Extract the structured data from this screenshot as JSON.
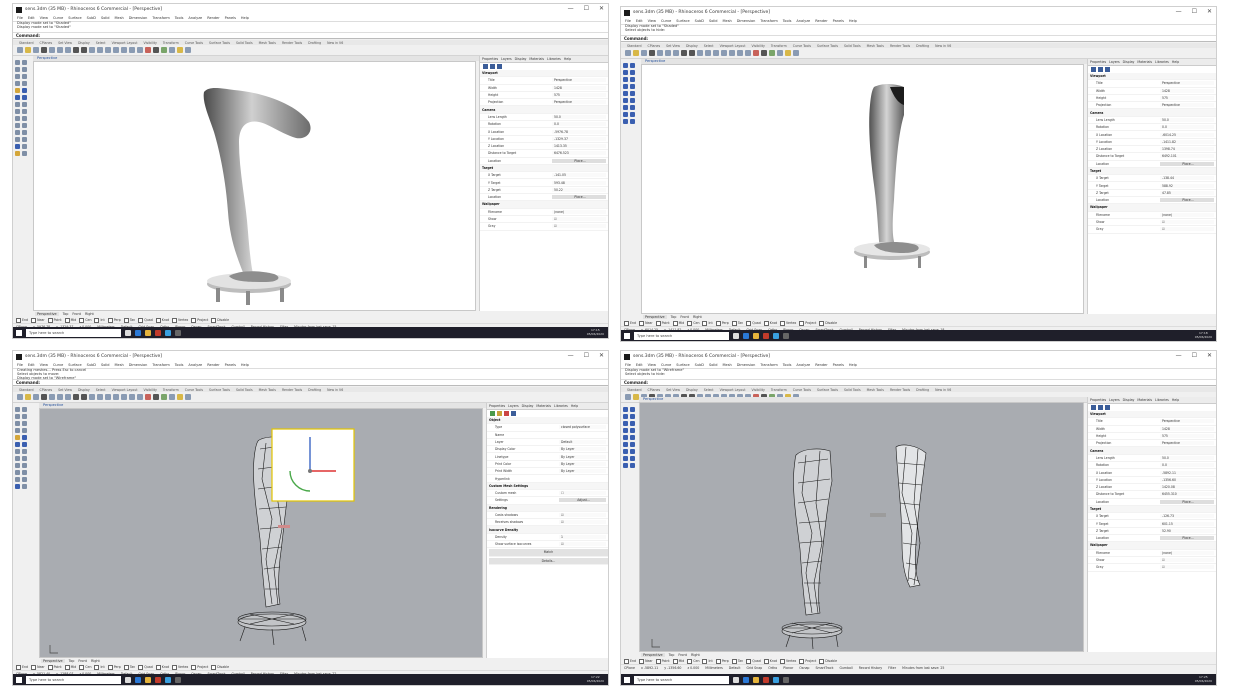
{
  "window_title": "sens.3dm (35 MB) - Rhinoceros 6 Commercial - [Perspective]",
  "window_controls": {
    "minimize": "—",
    "maximize": "☐",
    "close": "✕"
  },
  "menu": [
    "File",
    "Edit",
    "View",
    "Curve",
    "Surface",
    "SubD",
    "Solid",
    "Mesh",
    "Dimension",
    "Transform",
    "Tools",
    "Analyze",
    "Render",
    "Panels",
    "Help"
  ],
  "toolbar_tabs": [
    "Standard",
    "CPlanes",
    "Set View",
    "Display",
    "Select",
    "Viewport Layout",
    "Visibility",
    "Transform",
    "Curve Tools",
    "Surface Tools",
    "Solid Tools",
    "Mesh Tools",
    "Render Tools",
    "Drafting",
    "New in V6"
  ],
  "windows": [
    {
      "command_history": [
        "Display mode set to \"Shaded\"",
        "Display mode set to \"Shaded\""
      ],
      "command_prompt": "Command:",
      "viewport_label": "Perspective",
      "panel_tabs": [
        "Properties",
        "Layers",
        "Display",
        "Materials",
        "Libraries",
        "Help"
      ],
      "properties": [
        {
          "section": "Viewport"
        },
        {
          "label": "Title",
          "value": "Perspective"
        },
        {
          "label": "Width",
          "value": "1428"
        },
        {
          "label": "Height",
          "value": "575"
        },
        {
          "label": "Projection",
          "value": "Perspective"
        },
        {
          "section": "Camera"
        },
        {
          "label": "Lens Length",
          "value": "50.0"
        },
        {
          "label": "Rotation",
          "value": "0.0"
        },
        {
          "label": "X Location",
          "value": "-5976.78"
        },
        {
          "label": "Y Location",
          "value": "-1329.37"
        },
        {
          "label": "Z Location",
          "value": "1413.35"
        },
        {
          "label": "Distance to Target",
          "value": "6476.523"
        },
        {
          "label": "Location",
          "value": "Place...",
          "button": true
        },
        {
          "section": "Target"
        },
        {
          "label": "X Target",
          "value": "-141.05"
        },
        {
          "label": "Y Target",
          "value": "593.48"
        },
        {
          "label": "Z Target",
          "value": "50.22"
        },
        {
          "label": "Location",
          "value": "Place...",
          "button": true
        },
        {
          "section": "Wallpaper"
        },
        {
          "label": "Filename",
          "value": "(none)"
        },
        {
          "label": "Show",
          "value": "☑"
        },
        {
          "label": "Gray",
          "value": "☑"
        }
      ],
      "viewport_tabs": [
        "Perspective",
        "Top",
        "Front",
        "Right"
      ],
      "osnaps": [
        "End",
        "Near",
        "Point",
        "Mid",
        "Cen",
        "Int",
        "Perp",
        "Tan",
        "Quad",
        "Knot",
        "Vertex",
        "Project",
        "Disable"
      ],
      "status": [
        "CPlane",
        "x -5976.78",
        "y -1329.37",
        "z 0.000",
        "Millimeters",
        "Default",
        "Grid Snap",
        "Ortho",
        "Planar",
        "Osnap",
        "SmartTrack",
        "Gumball",
        "Record History",
        "Filter",
        "Minutes from last save: 15"
      ],
      "taskbar_search": "Type here to search",
      "clock_time": "17:15",
      "clock_date": "05/06/2020"
    },
    {
      "command_history": [
        "Display mode set to \"Shaded\"",
        "Select objects to hide:"
      ],
      "command_prompt": "Command:",
      "viewport_label": "Perspective",
      "panel_tabs": [
        "Properties",
        "Layers",
        "Display",
        "Materials",
        "Libraries",
        "Help"
      ],
      "properties": [
        {
          "section": "Viewport"
        },
        {
          "label": "Title",
          "value": "Perspective"
        },
        {
          "label": "Width",
          "value": "1428"
        },
        {
          "label": "Height",
          "value": "575"
        },
        {
          "label": "Projection",
          "value": "Perspective"
        },
        {
          "section": "Camera"
        },
        {
          "label": "Lens Length",
          "value": "50.0"
        },
        {
          "label": "Rotation",
          "value": "0.0"
        },
        {
          "label": "X Location",
          "value": "-6014.25"
        },
        {
          "label": "Y Location",
          "value": "-1411.82"
        },
        {
          "label": "Z Location",
          "value": "1398.74"
        },
        {
          "label": "Distance to Target",
          "value": "6492.101"
        },
        {
          "label": "Location",
          "value": "Place...",
          "button": true
        },
        {
          "section": "Target"
        },
        {
          "label": "X Target",
          "value": "-138.44"
        },
        {
          "label": "Y Target",
          "value": "588.92"
        },
        {
          "label": "Z Target",
          "value": "47.85"
        },
        {
          "label": "Location",
          "value": "Place...",
          "button": true
        },
        {
          "section": "Wallpaper"
        },
        {
          "label": "Filename",
          "value": "(none)"
        },
        {
          "label": "Show",
          "value": "☑"
        },
        {
          "label": "Gray",
          "value": "☑"
        }
      ],
      "viewport_tabs": [
        "Perspective",
        "Top",
        "Front",
        "Right"
      ],
      "osnaps": [
        "End",
        "Near",
        "Point",
        "Mid",
        "Cen",
        "Int",
        "Perp",
        "Tan",
        "Quad",
        "Knot",
        "Vertex",
        "Project",
        "Disable"
      ],
      "status": [
        "CPlane",
        "x -6014.25",
        "y -1411.82",
        "z 0.000",
        "Millimeters",
        "Default",
        "Grid Snap",
        "Ortho",
        "Planar",
        "Osnap",
        "SmartTrack",
        "Gumball",
        "Record History",
        "Filter",
        "Minutes from last save: 18"
      ],
      "taskbar_search": "Type here to search",
      "clock_time": "17:18",
      "clock_date": "05/06/2020"
    },
    {
      "command_history": [
        "Creating meshes... Press Esc to cancel",
        "Select objects to move:",
        "Display mode set to \"Wireframe\""
      ],
      "command_prompt": "Command:",
      "viewport_label": "Perspective",
      "panel_tabs": [
        "Properties",
        "Layers",
        "Display",
        "Materials",
        "Libraries",
        "Help"
      ],
      "properties": [
        {
          "section": "Object"
        },
        {
          "label": "Type",
          "value": "closed polysurface"
        },
        {
          "label": "Name",
          "value": ""
        },
        {
          "label": "Layer",
          "value": "Default"
        },
        {
          "label": "Display Color",
          "value": "By Layer"
        },
        {
          "label": "Linetype",
          "value": "By Layer"
        },
        {
          "label": "Print Color",
          "value": "By Layer"
        },
        {
          "label": "Print Width",
          "value": "By Layer"
        },
        {
          "label": "Hyperlink",
          "value": ""
        },
        {
          "section": "Custom Mesh Settings"
        },
        {
          "label": "Custom mesh",
          "value": "☐"
        },
        {
          "label": "Settings",
          "value": "Adjust...",
          "button": true
        },
        {
          "section": "Rendering"
        },
        {
          "label": "Casts shadows",
          "value": "☑"
        },
        {
          "label": "Receives shadows",
          "value": "☑"
        },
        {
          "section": "Isocurve Density"
        },
        {
          "label": "Density",
          "value": "1"
        },
        {
          "label": "Show surface isocurves",
          "value": "☑"
        },
        {
          "fullbutton": "Match"
        },
        {
          "fullbutton": "Details..."
        }
      ],
      "viewport_tabs": [
        "Perspective",
        "Top",
        "Front",
        "Right"
      ],
      "osnaps": [
        "End",
        "Near",
        "Point",
        "Mid",
        "Cen",
        "Int",
        "Perp",
        "Tan",
        "Quad",
        "Knot",
        "Vertex",
        "Project",
        "Disable"
      ],
      "status": [
        "CPlane",
        "x -5821.40",
        "y -1288.07",
        "z 0.000",
        "Millimeters",
        "Default",
        "Grid Snap",
        "Ortho",
        "Planar",
        "Osnap",
        "SmartTrack",
        "Gumball",
        "Record History",
        "Filter",
        "Minutes from last save: 22"
      ],
      "taskbar_search": "Type here to search",
      "clock_time": "17:22",
      "clock_date": "05/06/2020"
    },
    {
      "command_history": [
        "Display mode set to \"Wireframe\"",
        "Select objects to hide:"
      ],
      "command_prompt": "Command:",
      "viewport_label": "Perspective",
      "panel_tabs": [
        "Properties",
        "Layers",
        "Display",
        "Materials",
        "Libraries",
        "Help"
      ],
      "properties": [
        {
          "section": "Viewport"
        },
        {
          "label": "Title",
          "value": "Perspective"
        },
        {
          "label": "Width",
          "value": "1428"
        },
        {
          "label": "Height",
          "value": "575"
        },
        {
          "label": "Projection",
          "value": "Perspective"
        },
        {
          "section": "Camera"
        },
        {
          "label": "Lens Length",
          "value": "50.0"
        },
        {
          "label": "Rotation",
          "value": "0.0"
        },
        {
          "label": "X Location",
          "value": "-5892.11"
        },
        {
          "label": "Y Location",
          "value": "-1356.60"
        },
        {
          "label": "Z Location",
          "value": "1420.08"
        },
        {
          "label": "Distance to Target",
          "value": "6455.310"
        },
        {
          "label": "Location",
          "value": "Place...",
          "button": true
        },
        {
          "section": "Target"
        },
        {
          "label": "X Target",
          "value": "-126.73"
        },
        {
          "label": "Y Target",
          "value": "601.15"
        },
        {
          "label": "Z Target",
          "value": "52.90"
        },
        {
          "label": "Location",
          "value": "Place...",
          "button": true
        },
        {
          "section": "Wallpaper"
        },
        {
          "label": "Filename",
          "value": "(none)"
        },
        {
          "label": "Show",
          "value": "☑"
        },
        {
          "label": "Gray",
          "value": "☑"
        }
      ],
      "viewport_tabs": [
        "Perspective",
        "Top",
        "Front",
        "Right"
      ],
      "osnaps": [
        "End",
        "Near",
        "Point",
        "Mid",
        "Cen",
        "Int",
        "Perp",
        "Tan",
        "Quad",
        "Knot",
        "Vertex",
        "Project",
        "Disable"
      ],
      "status": [
        "CPlane",
        "x -5892.11",
        "y -1356.60",
        "z 0.000",
        "Millimeters",
        "Default",
        "Grid Snap",
        "Ortho",
        "Planar",
        "Osnap",
        "SmartTrack",
        "Gumball",
        "Record History",
        "Filter",
        "Minutes from last save: 25"
      ],
      "taskbar_search": "Type here to search",
      "clock_time": "17:25",
      "clock_date": "05/06/2020"
    }
  ]
}
